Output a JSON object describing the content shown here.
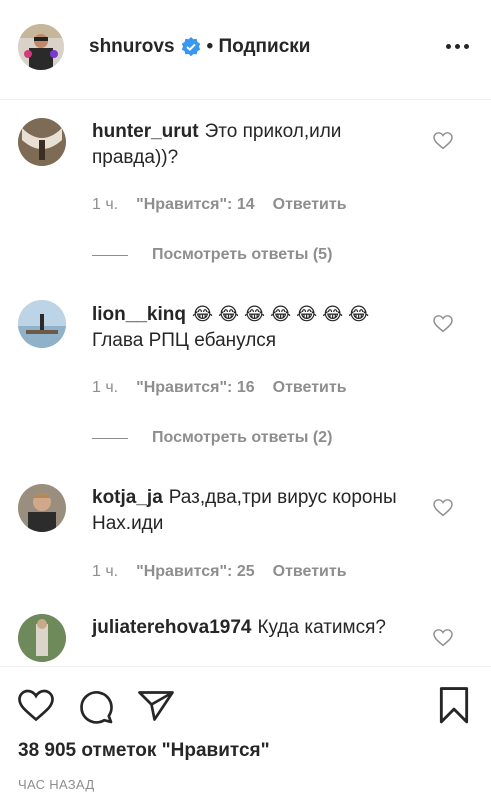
{
  "header": {
    "username": "shnurovs",
    "follow_status": "• Подписки"
  },
  "comments": [
    {
      "username": "hunter_urut",
      "text": "Это прикол,или правда))?",
      "time": "1 ч.",
      "likes": "\"Нравится\": 14",
      "reply_label": "Ответить",
      "view_replies": "Посмотреть ответы (5)"
    },
    {
      "username": "lion__kinq",
      "emoji": "😂 😂 😂 😂 😂 😂 😂",
      "text": "Глава РПЦ ебанулся",
      "time": "1 ч.",
      "likes": "\"Нравится\": 16",
      "reply_label": "Ответить",
      "view_replies": "Посмотреть ответы (2)"
    },
    {
      "username": "kotja_ja",
      "text": "Раз,два,три вирус короны Нах.иди",
      "time": "1 ч.",
      "likes": "\"Нравится\": 25",
      "reply_label": "Ответить"
    },
    {
      "username": "juliaterehova1974",
      "text": "Куда катимся?"
    }
  ],
  "footer": {
    "likes_count": "38 905 отметок \"Нравится\"",
    "posted_ago": "ЧАС НАЗАД"
  }
}
